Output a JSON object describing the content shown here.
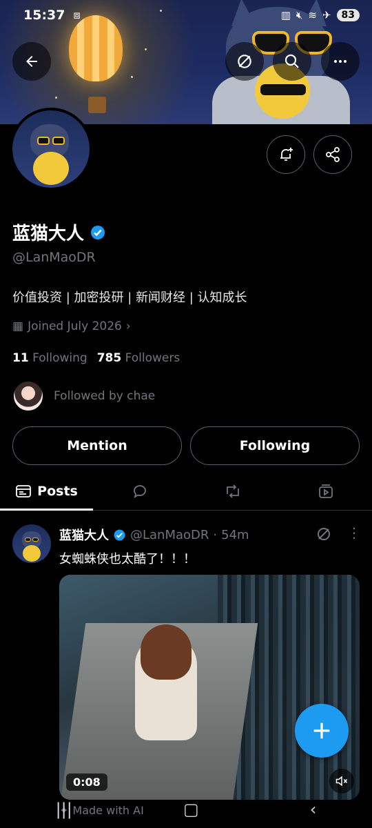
{
  "status_bar": {
    "time": "15:37",
    "battery": "83"
  },
  "profile": {
    "display_name": "蓝猫大人",
    "handle": "@LanMaoDR",
    "bio": "价值投资 | 加密投研 | 新闻财经 | 认知成长",
    "joined": "Joined July 2026",
    "following_count": "11",
    "following_label": "Following",
    "followers_count": "785",
    "followers_label": "Followers",
    "followed_by": "Followed by chae"
  },
  "actions": {
    "mention": "Mention",
    "following": "Following"
  },
  "tabs": [
    {
      "label": "Posts",
      "icon": "posts-icon"
    },
    {
      "icon": "replies-icon"
    },
    {
      "icon": "repost-icon"
    },
    {
      "icon": "media-icon"
    }
  ],
  "post": {
    "name": "蓝猫大人",
    "handle": "@LanMaoDR",
    "time": "54m",
    "text": "女蜘蛛侠也太酷了！！！",
    "video_duration": "0:08",
    "made_with_ai": "Made with AI"
  },
  "colors": {
    "accent": "#1d9bf0",
    "verified": "#1d9bf0",
    "muted": "#71767b"
  }
}
